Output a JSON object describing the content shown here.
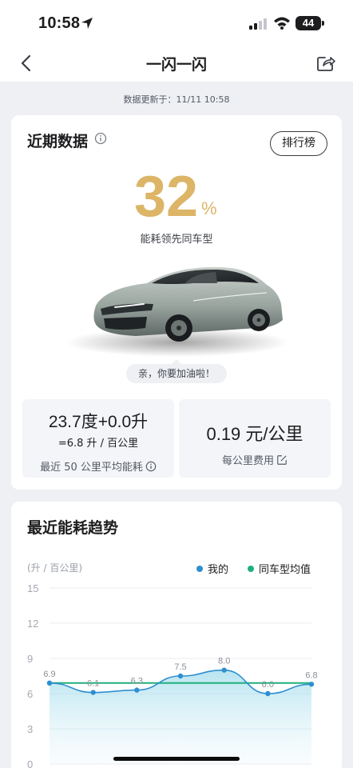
{
  "status_bar": {
    "time": "10:58",
    "battery": "44"
  },
  "nav": {
    "title": "一闪一闪"
  },
  "update": {
    "text": "数据更新于：11/11 10:58"
  },
  "recent": {
    "title": "近期数据",
    "rank_button": "排行榜",
    "percent": "32",
    "percent_sign": "%",
    "lead_label": "能耗领先同车型",
    "tip": "亲，你要加油啦！",
    "consumption": {
      "main": "23.7度+0.0升",
      "sub": "=6.8 升 / 百公里",
      "caption": "最近 50 公里平均能耗"
    },
    "cost": {
      "main": "0.19 元/公里",
      "caption": "每公里费用"
    }
  },
  "trend": {
    "title": "最近能耗趋势",
    "unit": "(升 / 百公里)",
    "legend": [
      {
        "label": "我的",
        "color": "#2e8fd0"
      },
      {
        "label": "同车型均值",
        "color": "#1fb07a"
      }
    ]
  },
  "chart_data": {
    "type": "line",
    "ylabel": "(升 / 百公里)",
    "ylim": [
      0,
      15
    ],
    "yticks": [
      "15",
      "12",
      "9",
      "6",
      "3",
      "0"
    ],
    "series": [
      {
        "name": "我的",
        "color": "#2e8fd0",
        "values": [
          6.9,
          6.1,
          6.3,
          7.5,
          8.0,
          6.0,
          6.8
        ],
        "labels": [
          "6.9",
          "6.1",
          "6.3",
          "7.5",
          "8.0",
          "6.0",
          "6.8"
        ]
      },
      {
        "name": "同车型均值",
        "color": "#1fb07a",
        "values": [
          6.9,
          6.9,
          6.9,
          6.9,
          6.9,
          6.9,
          6.9
        ]
      }
    ],
    "grid": true
  }
}
